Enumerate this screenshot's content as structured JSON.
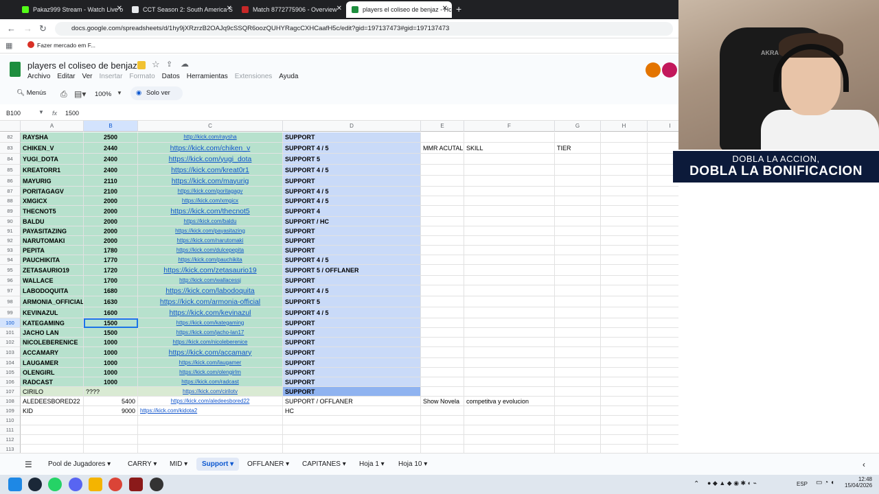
{
  "browser": {
    "tabs": [
      {
        "label": "Pakaz999 Stream - Watch Live o",
        "color": "#53fc18"
      },
      {
        "label": "CCT Season 2: South America S",
        "color": "#e8eaed"
      },
      {
        "label": "Match 8772775906 - Overview",
        "color": "#c62828"
      },
      {
        "label": "players el coliseo de benjaz - Hc",
        "color": "#1e8e3e"
      }
    ],
    "url": "docs.google.com/spreadsheets/d/1hy9jXRzrzB2OAJq9cSSQR6oozQUHYRagcCXHCaafH5c/edit?gid=197137473#gid=197137473",
    "bookmark": "Fazer mercado em F..."
  },
  "doc": {
    "title": "players el coliseo de benjaz",
    "menus": [
      "Archivo",
      "Editar",
      "Ver",
      "Insertar",
      "Formato",
      "Datos",
      "Herramientas",
      "Extensiones",
      "Ayuda"
    ],
    "menus_disabled": [
      "Insertar",
      "Formato",
      "Extensiones"
    ]
  },
  "toolbar": {
    "menus_label": "Menús",
    "zoom": "100%",
    "view_mode": "Solo ver"
  },
  "formula": {
    "cell_ref": "B100",
    "fx": "fx",
    "value": "1500"
  },
  "columns": [
    "A",
    "B",
    "C",
    "D",
    "E",
    "F",
    "G",
    "H",
    "I"
  ],
  "rows": [
    {
      "n": "82",
      "name": "RAYSHA",
      "mmr": "2500",
      "link": "http://kick.com/raysha",
      "role": "SUPPORT",
      "lsize": "small"
    },
    {
      "n": "83",
      "name": "CHIKEN_V",
      "mmr": "2440",
      "link": "https://kick.com/chiken_v",
      "role": "SUPPORT 4 / 5",
      "lsize": "big",
      "e": "MMR ACUTAL",
      "f": "SKILL",
      "g": "TIER"
    },
    {
      "n": "84",
      "name": "YUGI_DOTA",
      "mmr": "2400",
      "link": "https://kick.com/yugi_dota",
      "role": "SUPPORT 5",
      "lsize": "big"
    },
    {
      "n": "85",
      "name": "KREATORR1",
      "mmr": "2400",
      "link": "https://kick.com/kreat0r1",
      "role": "SUPPORT 4 / 5",
      "lsize": "big"
    },
    {
      "n": "86",
      "name": "MAYURIG",
      "mmr": "2110",
      "link": "https://kick.com/mayurig",
      "role": "SUPPORT",
      "lsize": "big"
    },
    {
      "n": "87",
      "name": "PORITAGAGV",
      "mmr": "2100",
      "link": "https://kick.com/poritagagv",
      "role": "SUPPORT 4 / 5",
      "lsize": "small"
    },
    {
      "n": "88",
      "name": "XMGICX",
      "mmr": "2000",
      "link": "https://kick.com/xmgicx",
      "role": "SUPPORT 4 / 5",
      "lsize": "small"
    },
    {
      "n": "89",
      "name": "THECNOT5",
      "mmr": "2000",
      "link": "https://kick.com/thecnot5",
      "role": "SUPPORT 4",
      "lsize": "big"
    },
    {
      "n": "90",
      "name": "BALDU",
      "mmr": "2000",
      "link": "https://kick.com/baldu",
      "role": "SUPPORT / HC",
      "lsize": "small"
    },
    {
      "n": "91",
      "name": "PAYASITAZING",
      "mmr": "2000",
      "link": "https://kick.com/payasitazing",
      "role": "SUPPORT",
      "lsize": "small"
    },
    {
      "n": "92",
      "name": "NARUTOMAKI",
      "mmr": "2000",
      "link": "https://kick.com/narutomaki",
      "role": "SUPPORT",
      "lsize": "small"
    },
    {
      "n": "93",
      "name": "PEPITA",
      "mmr": "1780",
      "link": "https://kick.com/dulcepepita",
      "role": "SUPPORT",
      "lsize": "small"
    },
    {
      "n": "94",
      "name": "PAUCHIKITA",
      "mmr": "1770",
      "link": "https://kick.com/pauchikita",
      "role": "SUPPORT 4 / 5",
      "lsize": "small"
    },
    {
      "n": "95",
      "name": "ZETASAURIO19",
      "mmr": "1720",
      "link": "https://kick.com/zetasaurio19",
      "role": "SUPPORT 5 / OFFLANER",
      "lsize": "big"
    },
    {
      "n": "96",
      "name": "WALLACE",
      "mmr": "1700",
      "link": "http://kick.com/wallacessj",
      "role": "SUPPORT",
      "lsize": "small"
    },
    {
      "n": "97",
      "name": "LABODOQUITA",
      "mmr": "1680",
      "link": "https://kick.com/labodoquita",
      "role": "SUPPORT 4 / 5",
      "lsize": "big"
    },
    {
      "n": "98",
      "name": "ARMONIA_OFFICIAL",
      "mmr": "1630",
      "link": "https://kick.com/armonia-official",
      "role": "SUPPORT 5",
      "lsize": "big"
    },
    {
      "n": "99",
      "name": "KEVINAZUL",
      "mmr": "1600",
      "link": "https://kick.com/kevinazul",
      "role": "SUPPORT 4 / 5",
      "lsize": "big"
    },
    {
      "n": "100",
      "name": "KATEGAMING",
      "mmr": "1500",
      "link": "https://kick.com/kategaming",
      "role": "SUPPORT",
      "lsize": "small",
      "selected": true
    },
    {
      "n": "101",
      "name": "JACHO LAN",
      "mmr": "1500",
      "link": "https://kick.com/jacho-lan17",
      "role": "SUPPORT",
      "lsize": "small"
    },
    {
      "n": "102",
      "name": "NICOLEBERENICE",
      "mmr": "1000",
      "link": "https://kick.com/nicoleberenice",
      "role": "SUPPORT",
      "lsize": "small"
    },
    {
      "n": "103",
      "name": "ACCAMARY",
      "mmr": "1000",
      "link": "https://kick.com/accamary",
      "role": "SUPPORT",
      "lsize": "big"
    },
    {
      "n": "104",
      "name": "LAUGAMER",
      "mmr": "1000",
      "link": "https://kick.com/laugamer",
      "role": "SUPPORT",
      "lsize": "small"
    },
    {
      "n": "105",
      "name": "OLENGIRL",
      "mmr": "1000",
      "link": "https://kick.com/olengirlm",
      "role": "SUPPORT",
      "lsize": "small"
    },
    {
      "n": "106",
      "name": "RADCAST",
      "mmr": "1000",
      "link": "https://kick.com/radcast",
      "role": "SUPPORT",
      "lsize": "small"
    },
    {
      "n": "107",
      "name": "CIRILO",
      "mmr": "????",
      "link": "https://kick.com/cirilotv",
      "role": "SUPPORT",
      "lsize": "small",
      "style": "cirilo"
    },
    {
      "n": "108",
      "name": "ALEDEESBORED22",
      "mmr": "5400",
      "link": "https://kick.com/aledeesbored22",
      "role": "SUPPORT / OFFLANER",
      "lsize": "small",
      "style": "plain",
      "e": "Show Novela",
      "f": "competitva y evolucion"
    },
    {
      "n": "109",
      "name": "KID",
      "mmr": "9000",
      "link": "https://kick.com/kidota2",
      "role": "HC",
      "lsize": "small",
      "style": "plain-left"
    },
    {
      "n": "110",
      "name": "",
      "mmr": "",
      "link": "",
      "role": "",
      "style": "empty"
    },
    {
      "n": "111",
      "name": "",
      "mmr": "",
      "link": "",
      "role": "",
      "style": "empty"
    },
    {
      "n": "112",
      "name": "",
      "mmr": "",
      "link": "",
      "role": "",
      "style": "empty"
    },
    {
      "n": "113",
      "name": "",
      "mmr": "",
      "link": "",
      "role": "",
      "style": "empty"
    }
  ],
  "sheet_tabs": [
    "Pool de Jugadores",
    "CARRY",
    "MID",
    "Support",
    "OFFLANER",
    "CAPITANES",
    "Hoja 1",
    "Hoja 10"
  ],
  "active_sheet": "Support",
  "taskbar": {
    "lang": "ESP",
    "time": "12:48",
    "date": "15/04/2026"
  },
  "stream_banner": {
    "line1": "DOBLA LA ACCION,",
    "line2": "DOBLA LA BONIFICACION"
  },
  "webcam_chair_text": "AKRAC"
}
